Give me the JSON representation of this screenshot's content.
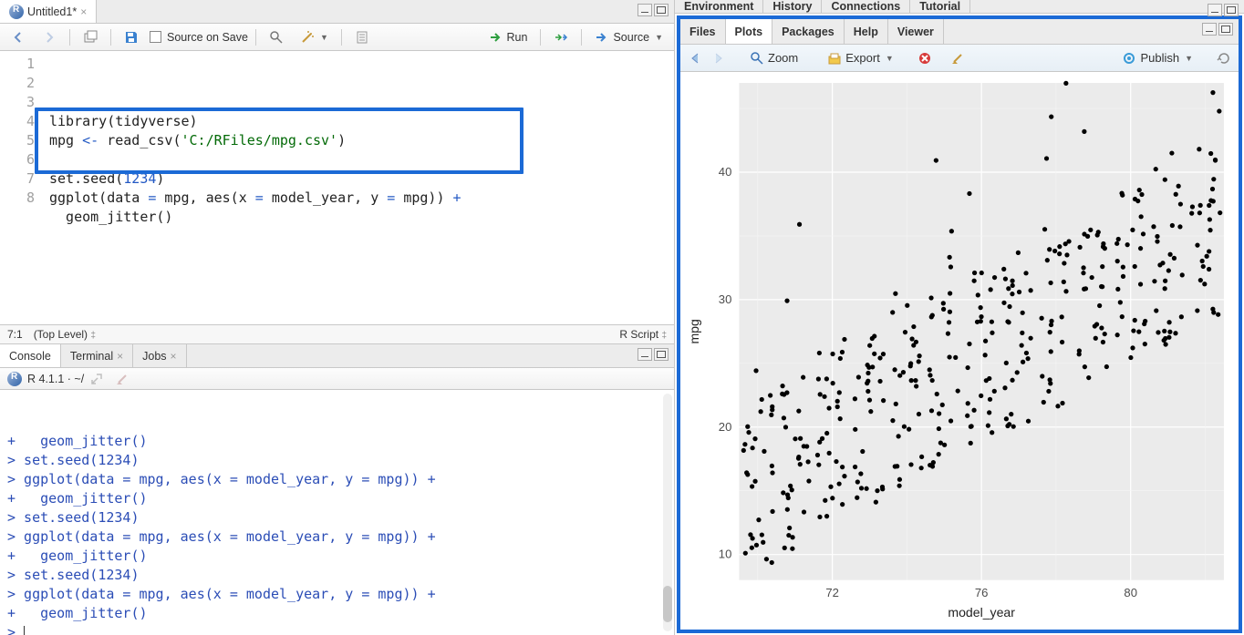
{
  "source_pane": {
    "file_tab": "Untitled1*",
    "toolbar": {
      "source_on_save": "Source on Save",
      "run": "Run",
      "source": "Source"
    },
    "lines": [
      {
        "n": 1,
        "tokens": [
          {
            "t": "library",
            "c": "code-black"
          },
          {
            "t": "(tidyverse)",
            "c": "code-black"
          }
        ]
      },
      {
        "n": 2,
        "tokens": [
          {
            "t": "mpg ",
            "c": "code-black"
          },
          {
            "t": "<-",
            "c": "code-blue"
          },
          {
            "t": " read_csv(",
            "c": "code-black"
          },
          {
            "t": "'C:/RFiles/mpg.csv'",
            "c": "code-str"
          },
          {
            "t": ")",
            "c": "code-black"
          }
        ]
      },
      {
        "n": 3,
        "tokens": []
      },
      {
        "n": 4,
        "tokens": [
          {
            "t": "set.seed(",
            "c": "code-black"
          },
          {
            "t": "1234",
            "c": "code-num"
          },
          {
            "t": ")",
            "c": "code-black"
          }
        ]
      },
      {
        "n": 5,
        "tokens": [
          {
            "t": "ggplot(data ",
            "c": "code-black"
          },
          {
            "t": "=",
            "c": "code-blue"
          },
          {
            "t": " mpg, aes(x ",
            "c": "code-black"
          },
          {
            "t": "=",
            "c": "code-blue"
          },
          {
            "t": " model_year, y ",
            "c": "code-black"
          },
          {
            "t": "=",
            "c": "code-blue"
          },
          {
            "t": " mpg)) ",
            "c": "code-black"
          },
          {
            "t": "+",
            "c": "code-blue"
          }
        ]
      },
      {
        "n": 6,
        "tokens": [
          {
            "t": "  geom_jitter()",
            "c": "code-black"
          }
        ]
      },
      {
        "n": 7,
        "tokens": []
      },
      {
        "n": 8,
        "tokens": []
      }
    ],
    "status": {
      "pos": "7:1",
      "scope": "(Top Level)",
      "lang": "R Script"
    }
  },
  "console_pane": {
    "tabs": [
      "Console",
      "Terminal",
      "Jobs"
    ],
    "header": "R 4.1.1 · ~/",
    "lines": [
      "+   geom_jitter()",
      "> set.seed(1234)",
      "> ggplot(data = mpg, aes(x = model_year, y = mpg)) +",
      "+   geom_jitter()",
      "> set.seed(1234)",
      "> ggplot(data = mpg, aes(x = model_year, y = mpg)) +",
      "+   geom_jitter()",
      "> set.seed(1234)",
      "> ggplot(data = mpg, aes(x = model_year, y = mpg)) +",
      "+   geom_jitter()",
      "> "
    ]
  },
  "right_top_tabs": [
    "Environment",
    "History",
    "Connections",
    "Tutorial"
  ],
  "right_mid_tabs": [
    "Files",
    "Plots",
    "Packages",
    "Help",
    "Viewer"
  ],
  "plot_toolbar": {
    "zoom": "Zoom",
    "export": "Export",
    "publish": "Publish"
  },
  "chart_data": {
    "type": "scatter",
    "title": "",
    "xlabel": "model_year",
    "ylabel": "mpg",
    "xlim": [
      69.5,
      82.5
    ],
    "ylim": [
      8,
      47
    ],
    "x_ticks": [
      72,
      76,
      80
    ],
    "y_ticks": [
      10,
      20,
      30,
      40
    ],
    "n_points": 398,
    "jitter_seed": 1234,
    "series": [
      {
        "name": "mpg",
        "x_source": "model_year_jittered",
        "y_source": "mpg"
      }
    ]
  }
}
